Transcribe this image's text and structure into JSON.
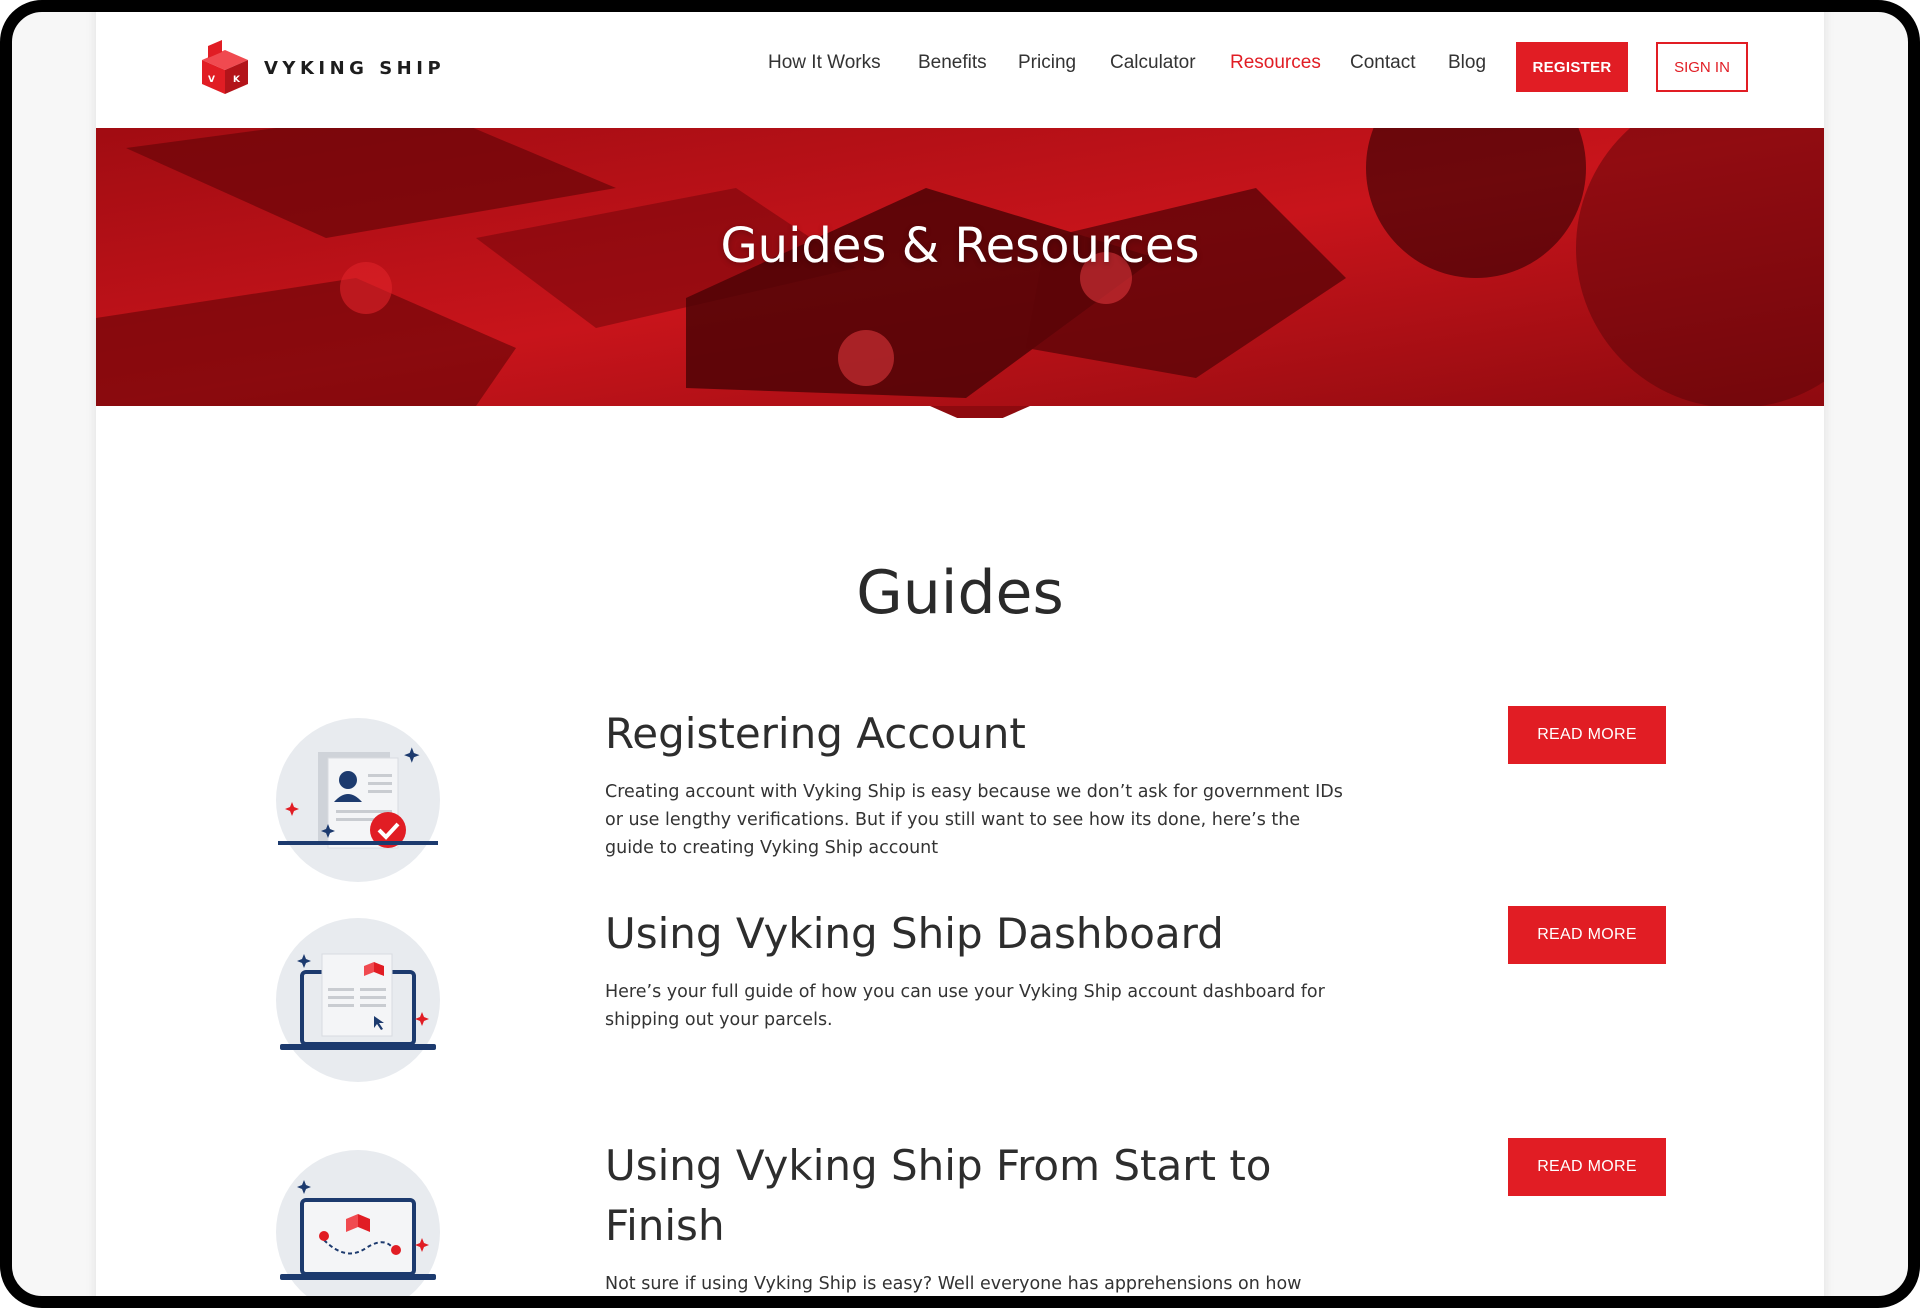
{
  "brand": {
    "name": "VYKING SHIP",
    "accent_color": "#e11d24"
  },
  "nav": {
    "items": [
      {
        "label": "How It Works"
      },
      {
        "label": "Benefits"
      },
      {
        "label": "Pricing"
      },
      {
        "label": "Calculator"
      },
      {
        "label": "Resources",
        "active": true
      },
      {
        "label": "Contact"
      },
      {
        "label": "Blog"
      }
    ],
    "register_label": "REGISTER",
    "signin_label": "SIGN IN"
  },
  "hero": {
    "title": "Guides & Resources"
  },
  "guides": {
    "title": "Guides",
    "items": [
      {
        "title": "Registering Account",
        "description": "Creating account with Vyking Ship is easy because we don’t ask for government IDs or use lengthy verifications. But if you still want to see how its done, here’s the guide to creating Vyking Ship account",
        "button": "READ MORE",
        "icon": "registration-document-icon"
      },
      {
        "title": "Using Vyking Ship Dashboard",
        "description": "Here’s your full guide of how you can use your Vyking Ship account dashboard for shipping out your parcels.",
        "button": "READ MORE",
        "icon": "laptop-dashboard-icon"
      },
      {
        "title": "Using Vyking Ship From Start to Finish",
        "description": "Not sure if using Vyking Ship is easy? Well everyone has apprehensions on how",
        "button": "READ MORE",
        "icon": "laptop-map-route-icon"
      }
    ]
  }
}
